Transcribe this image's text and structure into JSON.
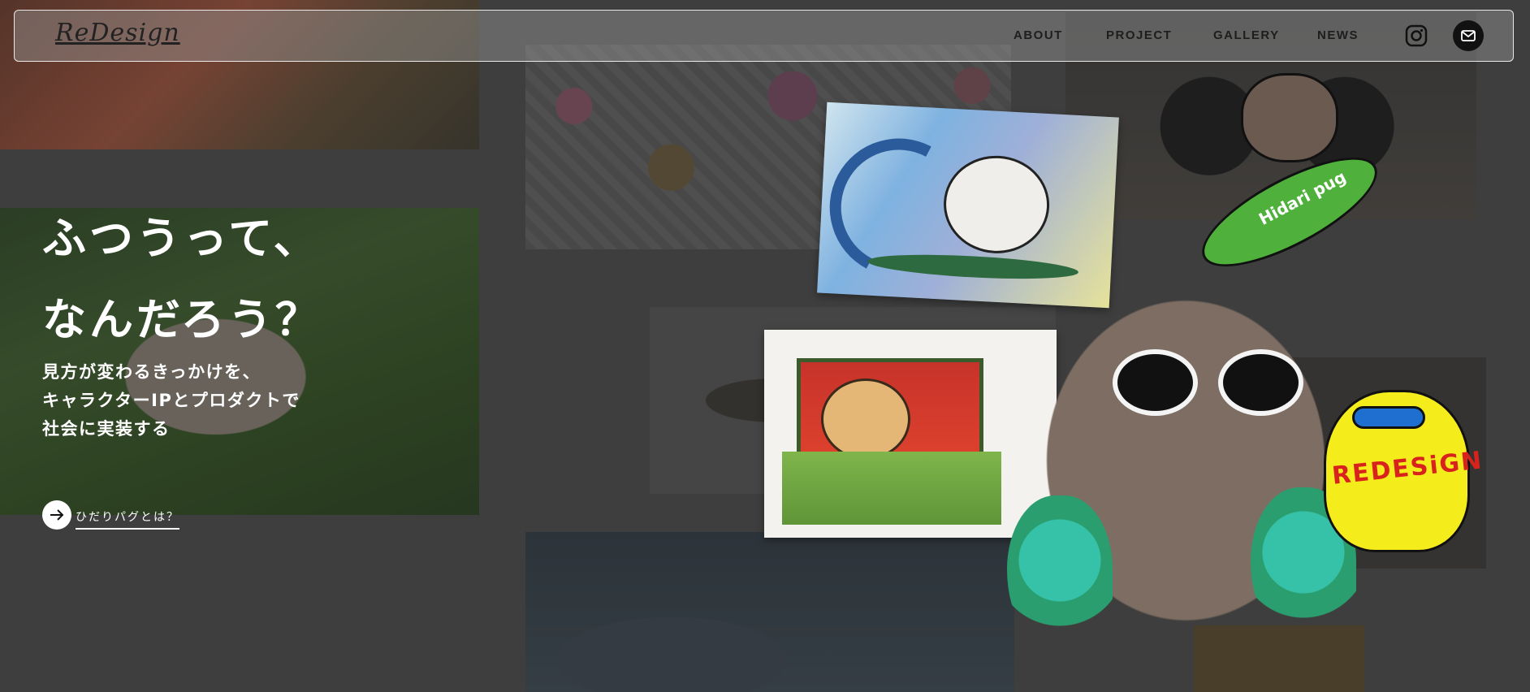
{
  "header": {
    "logo_text": "ReDesign",
    "nav": [
      {
        "label": "ABOUT"
      },
      {
        "label": "PROJECT"
      },
      {
        "label": "GALLERY"
      },
      {
        "label": "NEWS"
      }
    ],
    "icons": {
      "instagram": "instagram-icon",
      "mail": "mail-icon"
    }
  },
  "hero": {
    "title_line1": "ふつうって、",
    "title_line2": "なんだろう？",
    "sub_line1": "見方が変わるきっかけを、",
    "sub_line2": "キャラクターIPとプロダクトで",
    "sub_line3": "社会に実装する",
    "cta_label": "ひだりパグとは？",
    "cta_icon": "arrow-right-icon"
  },
  "illustrations": {
    "sticker_text": "REDESiGN",
    "surfboard_text": "Hidari pug"
  },
  "colors": {
    "overlay": "#4a4a4a",
    "text": "#ffffff",
    "nav_text": "#1e1e1e",
    "mail_bg": "#111111"
  }
}
